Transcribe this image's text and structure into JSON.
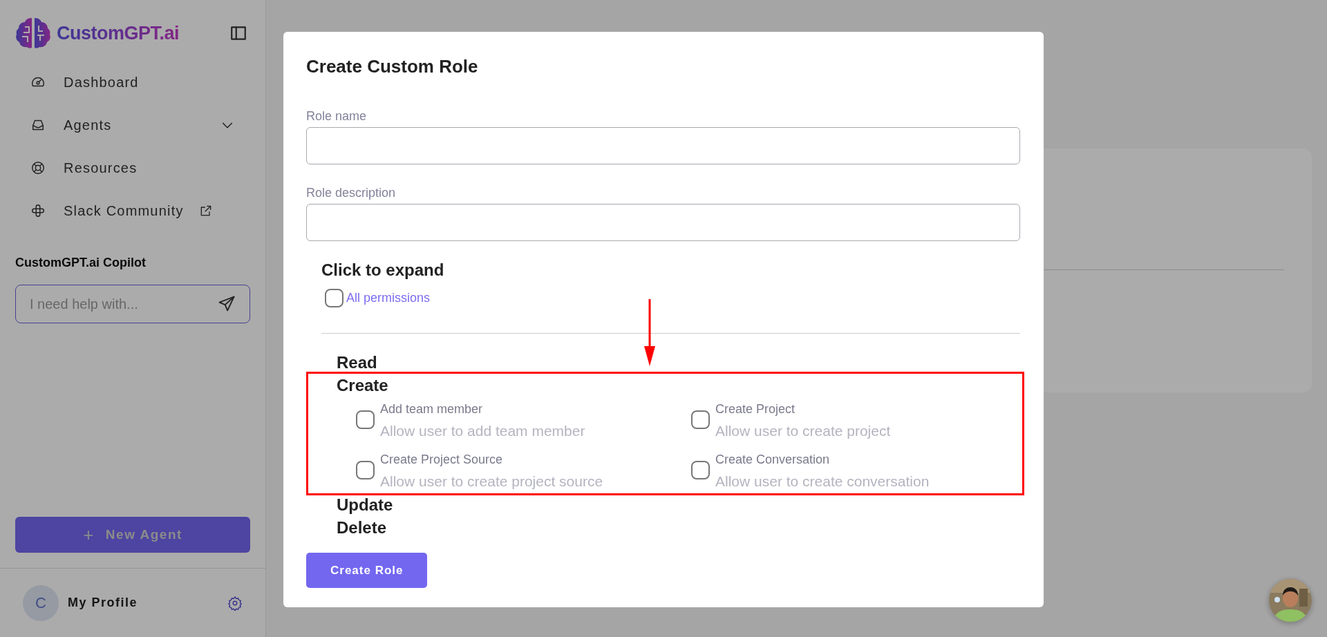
{
  "sidebar": {
    "brand": "CustomGPT.ai",
    "nav": [
      {
        "label": "Dashboard",
        "kind": "plain"
      },
      {
        "label": "Agents",
        "kind": "dropdown"
      },
      {
        "label": "Resources",
        "kind": "plain"
      },
      {
        "label": "Slack Community",
        "kind": "external"
      }
    ],
    "copilot": {
      "title": "CustomGPT.ai Copilot",
      "placeholder": "I need help with..."
    },
    "new_agent": {
      "icon": "+",
      "label": "New Agent"
    },
    "profile": {
      "initial": "C",
      "name": "My Profile"
    }
  },
  "modal": {
    "title": "Create Custom Role",
    "fields": [
      {
        "label": "Role name"
      },
      {
        "label": "Role description"
      }
    ],
    "expand_label": "Click to expand",
    "all_permissions": {
      "label": "All permissions",
      "checked": false
    },
    "groups": [
      {
        "name": "Read",
        "highlighted": false
      },
      {
        "name": "Create",
        "highlighted": true,
        "permissions": [
          {
            "label": "Add team member",
            "description": "Allow user to add team member",
            "checked": false
          },
          {
            "label": "Create Project",
            "description": "Allow user to create project",
            "checked": false
          },
          {
            "label": "Create Project Source",
            "description": "Allow user to create project source",
            "checked": false
          },
          {
            "label": "Create Conversation",
            "description": "Allow user to create conversation",
            "checked": false
          }
        ]
      },
      {
        "name": "Update",
        "highlighted": false
      },
      {
        "name": "Delete",
        "highlighted": false
      }
    ],
    "submit": "Create Role"
  }
}
